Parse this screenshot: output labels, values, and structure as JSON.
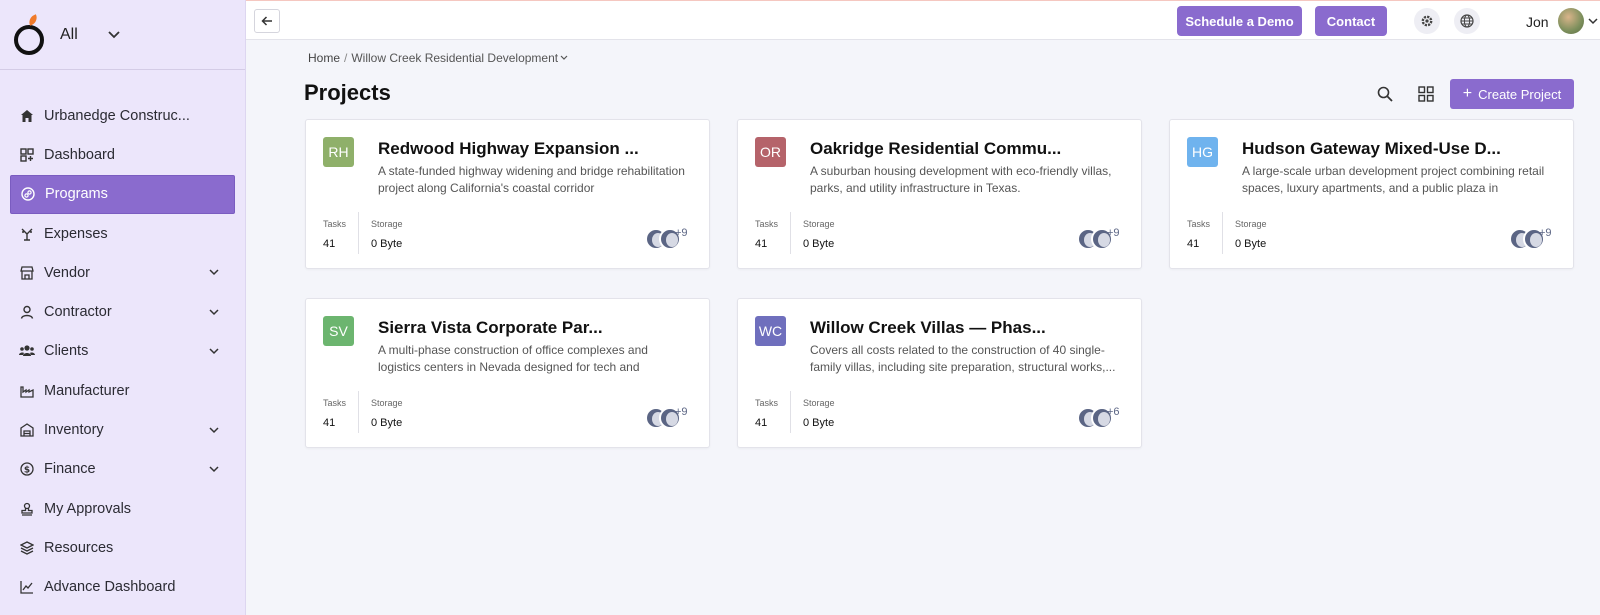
{
  "sidebar": {
    "scope_label": "All",
    "items": [
      {
        "label": "Urbanedge Construc...",
        "icon": "home-icon",
        "has_chevron": false
      },
      {
        "label": "Dashboard",
        "icon": "dashboard-icon",
        "has_chevron": false
      },
      {
        "label": "Programs",
        "icon": "programs-icon",
        "has_chevron": false,
        "active": true
      },
      {
        "label": "Expenses",
        "icon": "expenses-icon",
        "has_chevron": false
      },
      {
        "label": "Vendor",
        "icon": "store-icon",
        "has_chevron": true
      },
      {
        "label": "Contractor",
        "icon": "person-icon",
        "has_chevron": true
      },
      {
        "label": "Clients",
        "icon": "users-icon",
        "has_chevron": true
      },
      {
        "label": "Manufacturer",
        "icon": "factory-icon",
        "has_chevron": false
      },
      {
        "label": "Inventory",
        "icon": "warehouse-icon",
        "has_chevron": true
      },
      {
        "label": "Finance",
        "icon": "dollar-icon",
        "has_chevron": true
      },
      {
        "label": "My Approvals",
        "icon": "stamp-icon",
        "has_chevron": false
      },
      {
        "label": "Resources",
        "icon": "layers-icon",
        "has_chevron": false
      },
      {
        "label": "Advance Dashboard",
        "icon": "trend-icon",
        "has_chevron": false
      }
    ]
  },
  "topbar": {
    "schedule_demo": "Schedule a Demo",
    "contact": "Contact",
    "user_name": "Jon"
  },
  "breadcrumb": {
    "home": "Home",
    "separator": "/",
    "current": "Willow Creek Residential Development"
  },
  "page": {
    "title": "Projects",
    "create_label": "Create Project"
  },
  "labels": {
    "tasks": "Tasks",
    "storage": "Storage"
  },
  "projects": [
    {
      "initials": "RH",
      "color": "#8fb06a",
      "title": "Redwood Highway Expansion ...",
      "desc": "A state-funded highway widening and bridge rehabilitation project along California's coastal corridor",
      "tasks": "41",
      "storage": "0 Byte",
      "extra_members": "+9"
    },
    {
      "initials": "OR",
      "color": "#b5636a",
      "title": "Oakridge Residential Commu...",
      "desc": "A suburban housing development with eco-friendly villas, parks, and utility infrastructure in Texas.",
      "tasks": "41",
      "storage": "0 Byte",
      "extra_members": "+9"
    },
    {
      "initials": "HG",
      "color": "#6fb3ee",
      "title": "Hudson Gateway Mixed-Use D...",
      "desc": "A large-scale urban development project combining retail spaces, luxury apartments, and a public plaza in downtow...",
      "tasks": "41",
      "storage": "0 Byte",
      "extra_members": "+9"
    },
    {
      "initials": "SV",
      "color": "#6cb56f",
      "title": "Sierra Vista Corporate Par...",
      "desc": "A multi-phase construction of office complexes and logistics centers in Nevada designed for tech and manufacturing...",
      "tasks": "41",
      "storage": "0 Byte",
      "extra_members": "+9"
    },
    {
      "initials": "WC",
      "color": "#6f6fbd",
      "title": "Willow Creek Villas — Phas...",
      "desc": "Covers all costs related to the construction of 40 single-family villas, including site preparation, structural works,...",
      "tasks": "41",
      "storage": "0 Byte",
      "extra_members": "+6"
    }
  ]
}
